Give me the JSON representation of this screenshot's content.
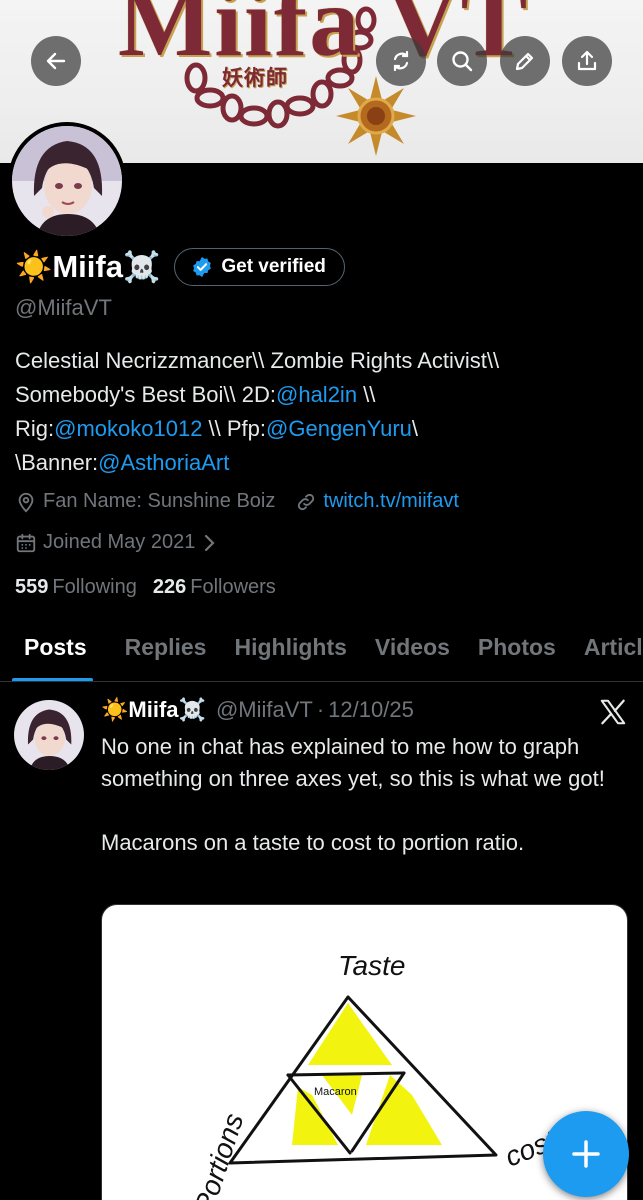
{
  "banner": {
    "logo_text": "Miifa VT",
    "kanji": "妖術師"
  },
  "profile": {
    "display_name": "Miifa",
    "emoji_prefix": "☀️",
    "emoji_suffix": "☠️",
    "verify_label": "Get verified",
    "handle": "@MiifaVT",
    "bio": {
      "line1": "Celestial Necrizzmancer\\\\ Zombie Rights Activist\\\\",
      "line2_text": "Somebody's Best Boi\\\\ 2D:",
      "line2_link": "@hal2in",
      "line2_tail": " \\\\",
      "line3_a": "Rig:",
      "line3_link1": "@mokoko1012",
      "line3_b": " \\\\ Pfp:",
      "line3_link2": "@GengenYuru",
      "line3_tail": "\\",
      "line4_a": "\\Banner:",
      "line4_link": "@AsthoriaArt"
    },
    "location": "Fan Name: Sunshine Boiz",
    "website": "twitch.tv/miifavt",
    "joined": "Joined May 2021",
    "following_count": "559",
    "following_label": "Following",
    "followers_count": "226",
    "followers_label": "Followers"
  },
  "tabs": [
    {
      "label": "Posts"
    },
    {
      "label": "Replies"
    },
    {
      "label": "Highlights"
    },
    {
      "label": "Videos"
    },
    {
      "label": "Photos"
    },
    {
      "label": "Articles"
    }
  ],
  "post": {
    "author": "Miifa",
    "emoji_prefix": "☀️",
    "emoji_suffix": "☠️",
    "handle": "@MiifaVT",
    "separator": "·",
    "date": "12/10/25",
    "text_p1": "No one in chat has explained to me how to graph something on three axes yet, so this is what we got!",
    "text_p2": "Macarons on a taste to cost to portion ratio.",
    "media": {
      "label_top": "Taste",
      "label_left": "Portions",
      "label_right": "cost",
      "label_center": "Macaron"
    }
  },
  "colors": {
    "accent": "#1d9bf0",
    "muted": "#71767b",
    "text": "#e7e9ea",
    "banner_red": "#7d2a36"
  },
  "icons": {
    "back": "arrow-left-icon",
    "retweet": "repost-icon",
    "search": "search-icon",
    "edit": "pencil-icon",
    "share": "share-icon",
    "location": "location-pin-icon",
    "link": "link-icon",
    "calendar": "calendar-icon",
    "verified": "verified-badge-icon",
    "x": "x-logo-icon",
    "compose": "plus-icon"
  }
}
